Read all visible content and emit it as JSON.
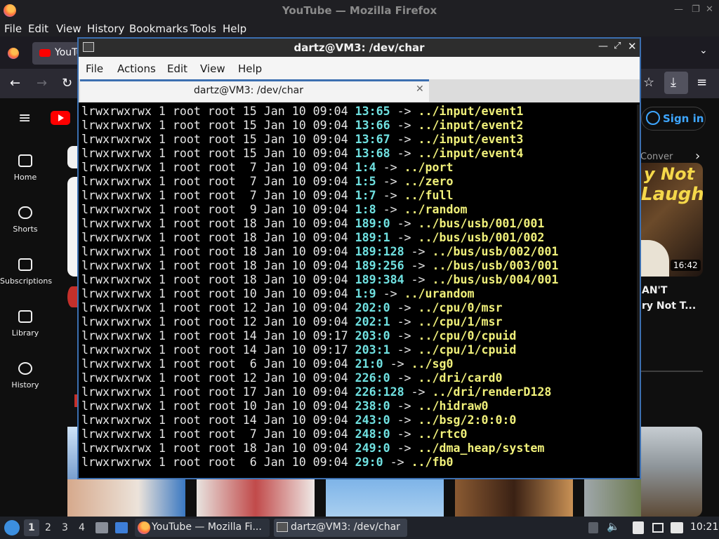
{
  "firefox": {
    "window_title": "YouTube — Mozilla Firefox",
    "menu": [
      "File",
      "Edit",
      "View",
      "History",
      "Bookmarks",
      "Tools",
      "Help"
    ],
    "tab_label": "YouTu"
  },
  "youtube": {
    "nav": [
      "Home",
      "Shorts",
      "Subscriptions",
      "Library",
      "History"
    ],
    "signin": "Sign in",
    "chip_partial": "Conver",
    "video": {
      "overlay_line1": "y Not",
      "overlay_line2": "Laugh",
      "duration": "16:42",
      "title_line1": "AN'T",
      "title_line2": "ry Not T..."
    }
  },
  "terminal": {
    "window_title": "dartz@VM3: /dev/char",
    "menu": [
      "File",
      "Actions",
      "Edit",
      "View",
      "Help"
    ],
    "tab_label": "dartz@VM3: /dev/char",
    "lines": [
      {
        "pre": "lrwxrwxrwx 1 root root 15 Jan 10 09:04 ",
        "dev": "13:65",
        "arrow": " -> ",
        "target": "../input/event1"
      },
      {
        "pre": "lrwxrwxrwx 1 root root 15 Jan 10 09:04 ",
        "dev": "13:66",
        "arrow": " -> ",
        "target": "../input/event2"
      },
      {
        "pre": "lrwxrwxrwx 1 root root 15 Jan 10 09:04 ",
        "dev": "13:67",
        "arrow": " -> ",
        "target": "../input/event3"
      },
      {
        "pre": "lrwxrwxrwx 1 root root 15 Jan 10 09:04 ",
        "dev": "13:68",
        "arrow": " -> ",
        "target": "../input/event4"
      },
      {
        "pre": "lrwxrwxrwx 1 root root  7 Jan 10 09:04 ",
        "dev": "1:4",
        "arrow": " -> ",
        "target": "../port"
      },
      {
        "pre": "lrwxrwxrwx 1 root root  7 Jan 10 09:04 ",
        "dev": "1:5",
        "arrow": " -> ",
        "target": "../zero"
      },
      {
        "pre": "lrwxrwxrwx 1 root root  7 Jan 10 09:04 ",
        "dev": "1:7",
        "arrow": " -> ",
        "target": "../full"
      },
      {
        "pre": "lrwxrwxrwx 1 root root  9 Jan 10 09:04 ",
        "dev": "1:8",
        "arrow": " -> ",
        "target": "../random"
      },
      {
        "pre": "lrwxrwxrwx 1 root root 18 Jan 10 09:04 ",
        "dev": "189:0",
        "arrow": " -> ",
        "target": "../bus/usb/001/001"
      },
      {
        "pre": "lrwxrwxrwx 1 root root 18 Jan 10 09:04 ",
        "dev": "189:1",
        "arrow": " -> ",
        "target": "../bus/usb/001/002"
      },
      {
        "pre": "lrwxrwxrwx 1 root root 18 Jan 10 09:04 ",
        "dev": "189:128",
        "arrow": " -> ",
        "target": "../bus/usb/002/001"
      },
      {
        "pre": "lrwxrwxrwx 1 root root 18 Jan 10 09:04 ",
        "dev": "189:256",
        "arrow": " -> ",
        "target": "../bus/usb/003/001"
      },
      {
        "pre": "lrwxrwxrwx 1 root root 18 Jan 10 09:04 ",
        "dev": "189:384",
        "arrow": " -> ",
        "target": "../bus/usb/004/001"
      },
      {
        "pre": "lrwxrwxrwx 1 root root 10 Jan 10 09:04 ",
        "dev": "1:9",
        "arrow": " -> ",
        "target": "../urandom"
      },
      {
        "pre": "lrwxrwxrwx 1 root root 12 Jan 10 09:04 ",
        "dev": "202:0",
        "arrow": " -> ",
        "target": "../cpu/0/msr"
      },
      {
        "pre": "lrwxrwxrwx 1 root root 12 Jan 10 09:04 ",
        "dev": "202:1",
        "arrow": " -> ",
        "target": "../cpu/1/msr"
      },
      {
        "pre": "lrwxrwxrwx 1 root root 14 Jan 10 09:17 ",
        "dev": "203:0",
        "arrow": " -> ",
        "target": "../cpu/0/cpuid"
      },
      {
        "pre": "lrwxrwxrwx 1 root root 14 Jan 10 09:17 ",
        "dev": "203:1",
        "arrow": " -> ",
        "target": "../cpu/1/cpuid"
      },
      {
        "pre": "lrwxrwxrwx 1 root root  6 Jan 10 09:04 ",
        "dev": "21:0",
        "arrow": " -> ",
        "target": "../sg0"
      },
      {
        "pre": "lrwxrwxrwx 1 root root 12 Jan 10 09:04 ",
        "dev": "226:0",
        "arrow": " -> ",
        "target": "../dri/card0"
      },
      {
        "pre": "lrwxrwxrwx 1 root root 17 Jan 10 09:04 ",
        "dev": "226:128",
        "arrow": " -> ",
        "target": "../dri/renderD128"
      },
      {
        "pre": "lrwxrwxrwx 1 root root 10 Jan 10 09:04 ",
        "dev": "238:0",
        "arrow": " -> ",
        "target": "../hidraw0"
      },
      {
        "pre": "lrwxrwxrwx 1 root root 14 Jan 10 09:04 ",
        "dev": "243:0",
        "arrow": " -> ",
        "target": "../bsg/2:0:0:0"
      },
      {
        "pre": "lrwxrwxrwx 1 root root  7 Jan 10 09:04 ",
        "dev": "248:0",
        "arrow": " -> ",
        "target": "../rtc0"
      },
      {
        "pre": "lrwxrwxrwx 1 root root 18 Jan 10 09:04 ",
        "dev": "249:0",
        "arrow": " -> ",
        "target": "../dma_heap/system"
      },
      {
        "pre": "lrwxrwxrwx 1 root root  6 Jan 10 09:04 ",
        "dev": "29:0",
        "arrow": " -> ",
        "target": "../fb0"
      }
    ]
  },
  "taskbar": {
    "workspaces": [
      "1",
      "2",
      "3",
      "4"
    ],
    "tasks": [
      "YouTube — Mozilla Fi...",
      "dartz@VM3: /dev/char"
    ],
    "clock": "10:21"
  }
}
